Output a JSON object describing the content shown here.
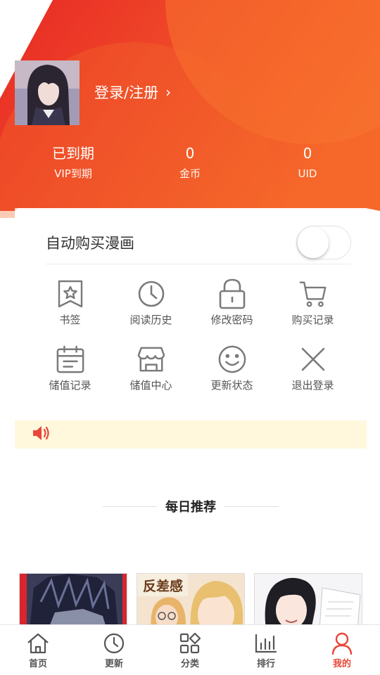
{
  "header": {
    "login_label": "登录/注册",
    "login_chevron": "›",
    "stats": [
      {
        "value": "已到期",
        "label": "VIP到期"
      },
      {
        "value": "0",
        "label": "金币"
      },
      {
        "value": "0",
        "label": "UID"
      }
    ]
  },
  "auto_buy": {
    "label": "自动购买漫画",
    "enabled": false
  },
  "menu": [
    {
      "icon": "bookmark-icon",
      "label": "书签"
    },
    {
      "icon": "clock-icon",
      "label": "阅读历史"
    },
    {
      "icon": "lock-icon",
      "label": "修改密码"
    },
    {
      "icon": "cart-icon",
      "label": "购买记录"
    },
    {
      "icon": "calendar-icon",
      "label": "储值记录"
    },
    {
      "icon": "store-icon",
      "label": "储值中心"
    },
    {
      "icon": "smile-icon",
      "label": "更新状态"
    },
    {
      "icon": "close-icon",
      "label": "退出登录"
    }
  ],
  "notice": {
    "icon": "speaker-icon",
    "text": ""
  },
  "recommend": {
    "title": "每日推荐"
  },
  "tabs": [
    {
      "icon": "home-icon",
      "label": "首页",
      "active": false
    },
    {
      "icon": "clock-icon",
      "label": "更新",
      "active": false
    },
    {
      "icon": "category-icon",
      "label": "分类",
      "active": false
    },
    {
      "icon": "ranking-icon",
      "label": "排行",
      "active": false
    },
    {
      "icon": "user-icon",
      "label": "我的",
      "active": true
    }
  ],
  "colors": {
    "accent": "#e8463a",
    "header_start": "#ec2f2a",
    "header_end": "#f56a2b",
    "notice_bg": "#fff8dc"
  }
}
